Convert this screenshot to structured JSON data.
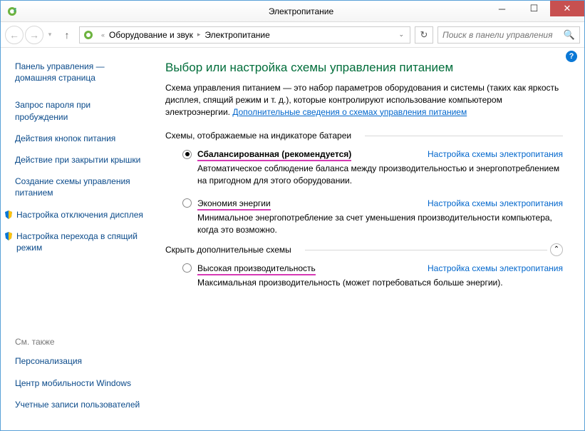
{
  "window": {
    "title": "Электропитание"
  },
  "breadcrumb": {
    "level1": "Оборудование и звук",
    "level2": "Электропитание"
  },
  "search": {
    "placeholder": "Поиск в панели управления"
  },
  "sidebar": {
    "home": "Панель управления — домашняя страница",
    "items": [
      "Запрос пароля при пробуждении",
      "Действия кнопок питания",
      "Действие при закрытии крышки",
      "Создание схемы управления питанием"
    ],
    "bulletItems": [
      "Настройка отключения дисплея",
      "Настройка перехода в спящий режим"
    ]
  },
  "seeAlso": {
    "title": "См. также",
    "links": [
      "Персонализация",
      "Центр мобильности Windows",
      "Учетные записи пользователей"
    ]
  },
  "main": {
    "heading": "Выбор или настройка схемы управления питанием",
    "intro": "Схема управления питанием — это набор параметров оборудования и системы (таких как яркость дисплея, спящий режим и т. д.), которые контролируют использование компьютером электроэнергии. ",
    "introLink": "Дополнительные сведения о схемах управления питанием",
    "section1": "Схемы, отображаемые на индикаторе батареи",
    "section2": "Скрыть дополнительные схемы",
    "changeLink": "Настройка схемы электропитания",
    "plans": [
      {
        "name": "Сбалансированная (рекомендуется)",
        "desc": "Автоматическое соблюдение баланса между производительностью и энергопотреблением на пригодном для этого оборудовании.",
        "selected": true
      },
      {
        "name": "Экономия энергии",
        "desc": "Минимальное энергопотребление за счет уменьшения производительности компьютера, когда это возможно.",
        "selected": false
      }
    ],
    "extraPlans": [
      {
        "name": "Высокая производительность",
        "desc": "Максимальная производительность (может потребоваться больше энергии).",
        "selected": false
      }
    ]
  }
}
